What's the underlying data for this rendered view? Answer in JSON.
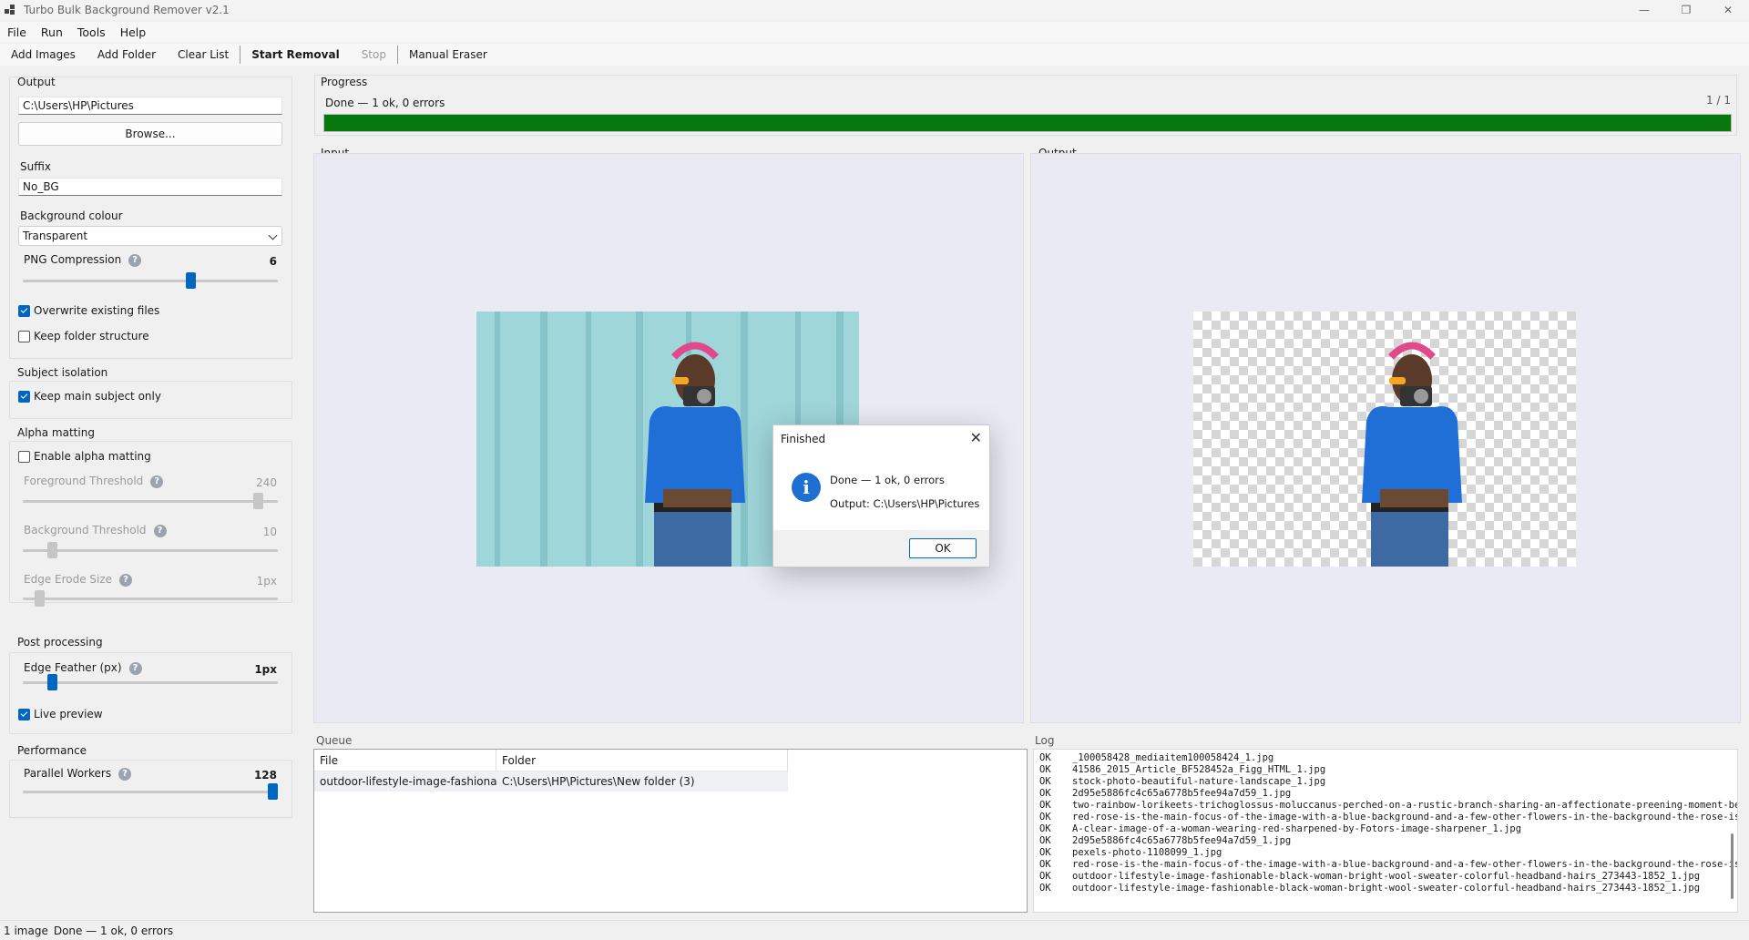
{
  "window": {
    "title": "Turbo Bulk Background Remover v2.1",
    "minimize_icon": "minimize-icon",
    "maximize_icon": "restore-icon",
    "close_icon": "close-icon"
  },
  "menu": {
    "items": [
      {
        "label": "File"
      },
      {
        "label": "Run"
      },
      {
        "label": "Tools"
      },
      {
        "label": "Help"
      }
    ]
  },
  "toolbar": {
    "add_images": "Add Images",
    "add_folder": "Add Folder",
    "clear_list": "Clear List",
    "start_removal": "Start Removal",
    "stop": "Stop",
    "manual_eraser": "Manual Eraser"
  },
  "output_group": {
    "title": "Output",
    "path": "C:\\Users\\HP\\Pictures",
    "browse": "Browse...",
    "suffix_label": "Suffix",
    "suffix": "No_BG",
    "bg_label": "Background colour",
    "bg_value": "Transparent",
    "png_label": "PNG Compression",
    "png_value": "6",
    "png_fraction": 0.6667,
    "overwrite_label": "Overwrite existing files",
    "overwrite": true,
    "keep_folder_label": "Keep folder structure",
    "keep_folder": false
  },
  "subject_group": {
    "title": "Subject isolation",
    "keep_main_label": "Keep main subject only",
    "keep_main": true
  },
  "alpha_group": {
    "title": "Alpha matting",
    "enable_label": "Enable alpha matting",
    "enable": false,
    "fg_label": "Foreground Threshold",
    "fg_value": "240",
    "fg_fraction": 0.94,
    "bg_label": "Background Threshold",
    "bg_value": "10",
    "bg_fraction": 0.1,
    "erode_label": "Edge Erode Size",
    "erode_value": "1px",
    "erode_fraction": 0.05
  },
  "post_group": {
    "title": "Post processing",
    "feather_label": "Edge Feather (px)",
    "feather_value": "1px",
    "feather_fraction": 0.1,
    "live_label": "Live preview",
    "live": true
  },
  "perf_group": {
    "title": "Performance",
    "workers_label": "Parallel Workers",
    "workers_value": "128",
    "workers_fraction": 1.0
  },
  "progress": {
    "title": "Progress",
    "status": "Done — 1 ok, 0 errors",
    "count": "1 / 1",
    "fraction": 1.0,
    "color": "#06780d"
  },
  "input_panel": {
    "title": "Input"
  },
  "output_panel": {
    "title": "Output"
  },
  "queue": {
    "title": "Queue",
    "columns": [
      "File",
      "Folder"
    ],
    "rows": [
      {
        "file": "outdoor-lifestyle-image-fashionab...",
        "folder": "C:\\Users\\HP\\Pictures\\New folder (3)"
      }
    ]
  },
  "log": {
    "title": "Log",
    "lines": [
      {
        "status": "OK",
        "text": "_100058428_mediaitem100058424_1.jpg"
      },
      {
        "status": "OK",
        "text": "41586_2015_Article_BF528452a_Figg_HTML_1.jpg"
      },
      {
        "status": "OK",
        "text": "stock-photo-beautiful-nature-landscape_1.jpg"
      },
      {
        "status": "OK",
        "text": "2d95e5886fc4c65a6778b5fee94a7d59_1.jpg"
      },
      {
        "status": "OK",
        "text": "two-rainbow-lorikeets-trichoglossus-moluccanus-perched-on-a-rustic-branch-sharing-an-affectionate-preening-moment-benea"
      },
      {
        "status": "OK",
        "text": "red-rose-is-the-main-focus-of-the-image-with-a-blue-background-and-a-few-other-flowers-in-the-background-the-rose-is-th"
      },
      {
        "status": "OK",
        "text": "A-clear-image-of-a-woman-wearing-red-sharpened-by-Fotors-image-sharpener_1.jpg"
      },
      {
        "status": "OK",
        "text": "2d95e5886fc4c65a6778b5fee94a7d59_1.jpg"
      },
      {
        "status": "OK",
        "text": "pexels-photo-1108099_1.jpg"
      },
      {
        "status": "OK",
        "text": "red-rose-is-the-main-focus-of-the-image-with-a-blue-background-and-a-few-other-flowers-in-the-background-the-rose-is-th"
      },
      {
        "status": "OK",
        "text": "outdoor-lifestyle-image-fashionable-black-woman-bright-wool-sweater-colorful-headband-hairs_273443-1852_1.jpg"
      },
      {
        "status": "OK",
        "text": "outdoor-lifestyle-image-fashionable-black-woman-bright-wool-sweater-colorful-headband-hairs_273443-1852_1.jpg"
      }
    ]
  },
  "dialog": {
    "title": "Finished",
    "icon": "info-icon",
    "line1": "Done — 1 ok, 0 errors",
    "line2": "Output: C:\\Users\\HP\\Pictures",
    "ok": "OK"
  },
  "statusbar": {
    "count": "1 image",
    "status": "Done — 1 ok, 0 errors"
  },
  "colors": {
    "accent": "#0067c0",
    "progress": "#06780d",
    "teal_bg": "#9fd6da",
    "sweater": "#1f6fd6"
  }
}
